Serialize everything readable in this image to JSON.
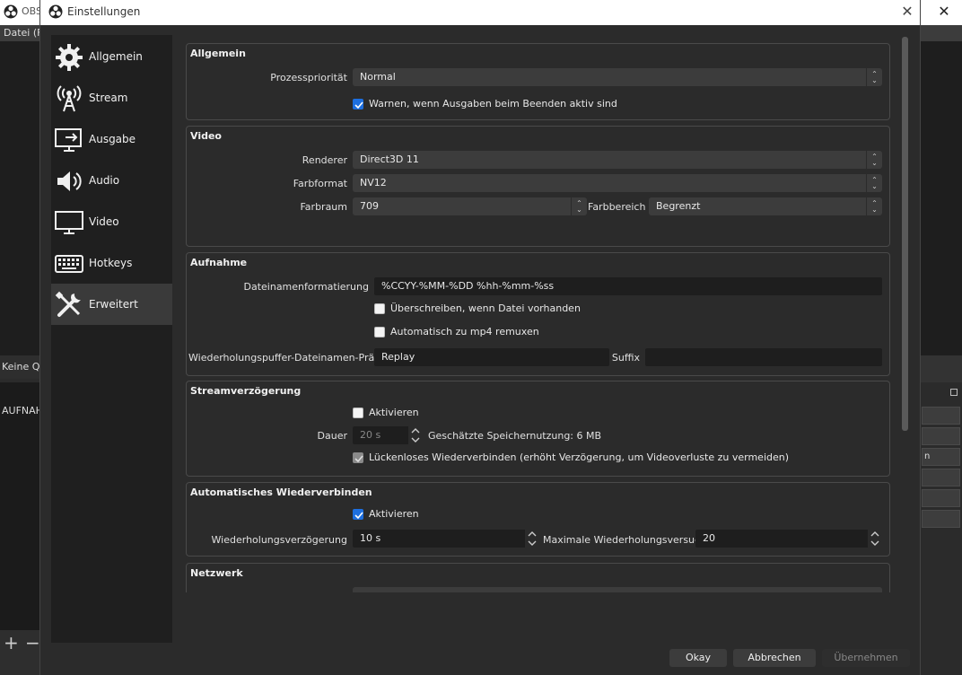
{
  "background": {
    "title": "OBS",
    "menu": "Datei (F",
    "scenes_label": "Keine Qu",
    "scene_item": "AUFNAH",
    "right_buttons": [
      "",
      "",
      "n",
      "",
      "",
      ""
    ]
  },
  "dialog": {
    "title": "Einstellungen"
  },
  "sidebar": {
    "items": [
      {
        "label": "Allgemein",
        "icon": "gear-icon"
      },
      {
        "label": "Stream",
        "icon": "antenna-icon"
      },
      {
        "label": "Ausgabe",
        "icon": "output-monitor-icon"
      },
      {
        "label": "Audio",
        "icon": "speaker-icon"
      },
      {
        "label": "Video",
        "icon": "monitor-icon"
      },
      {
        "label": "Hotkeys",
        "icon": "keyboard-icon"
      },
      {
        "label": "Erweitert",
        "icon": "tools-icon"
      }
    ],
    "active": "Erweitert"
  },
  "general": {
    "title": "Allgemein",
    "priority_label": "Prozesspriorität",
    "priority_value": "Normal",
    "warn_label": "Warnen, wenn Ausgaben beim Beenden aktiv sind",
    "warn_checked": true
  },
  "video": {
    "title": "Video",
    "renderer_label": "Renderer",
    "renderer_value": "Direct3D 11",
    "format_label": "Farbformat",
    "format_value": "NV12",
    "space_label": "Farbraum",
    "space_value": "709",
    "range_label": "Farbbereich",
    "range_value": "Begrenzt"
  },
  "recording": {
    "title": "Aufnahme",
    "filename_label": "Dateinamenformatierung",
    "filename_value": "%CCYY-%MM-%DD %hh-%mm-%ss",
    "overwrite_label": "Überschreiben, wenn Datei vorhanden",
    "remux_label": "Automatisch zu mp4 remuxen",
    "replay_label": "Wiederholungspuffer-Dateinamen-Präfix",
    "replay_value": "Replay",
    "suffix_label": "Suffix",
    "suffix_value": ""
  },
  "stream_delay": {
    "title": "Streamverzögerung",
    "enable_label": "Aktivieren",
    "duration_label": "Dauer",
    "duration_value": "20 s",
    "memory_label": "Geschätzte Speichernutzung: 6 MB",
    "reconnect_label": "Lückenloses Wiederverbinden (erhöht Verzögerung, um Videoverluste zu vermeiden)"
  },
  "auto_reconnect": {
    "title": "Automatisches Wiederverbinden",
    "enable_label": "Aktivieren",
    "delay_label": "Wiederholungsverzögerung",
    "delay_value": "10 s",
    "max_label": "Maximale Wiederholungsversuche",
    "max_value": "20"
  },
  "network": {
    "title": "Netzwerk"
  },
  "buttons": {
    "ok": "Okay",
    "cancel": "Abbrechen",
    "apply": "Übernehmen"
  },
  "colors": {
    "accent": "#1d6fe0",
    "background": "#2b2b2b",
    "sidebar": "#1f1f1f"
  }
}
